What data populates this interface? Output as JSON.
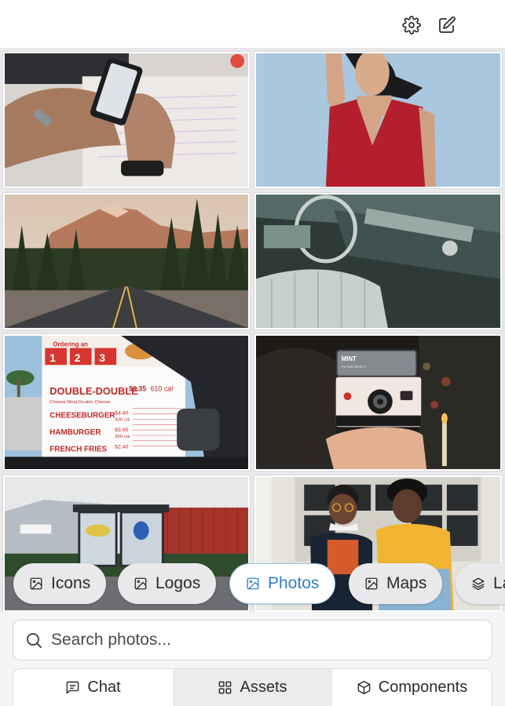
{
  "toolbar": {
    "settings_icon": "gear-icon",
    "compose_icon": "edit-icon"
  },
  "photos": [
    {
      "description": "Hands holding a smartphone over a notebook"
    },
    {
      "description": "Woman in a red dress against a blue sky"
    },
    {
      "description": "Road leading to a mountain through pine forest"
    },
    {
      "description": "Vintage car interior with green dashboard"
    },
    {
      "description": "Fast food menu board seen from a car",
      "menu": {
        "header": "Ordering an",
        "combos": [
          "1",
          "2",
          "3"
        ],
        "title": "DOUBLE-DOUBLE",
        "title_price": "$6.35",
        "title_cal": "610 cal",
        "subtitle": "Cheese Meat Double Cheese",
        "items": [
          {
            "name": "CHEESEBURGER",
            "price": "$4.40",
            "cal": "430 cal"
          },
          {
            "name": "HAMBURGER",
            "price": "$3.85",
            "cal": "360 cal"
          },
          {
            "name": "FRENCH FRIES",
            "price": "$2.40",
            "cal": ""
          }
        ]
      }
    },
    {
      "description": "Hand holding a vintage instant camera",
      "camera_label": "MINT",
      "camera_model": "FLASH BAR 2"
    },
    {
      "description": "Bus shelter in front of industrial buildings"
    },
    {
      "description": "Two smiling friends outdoors"
    }
  ],
  "categories": [
    {
      "label": "Icons",
      "icon": "image-icon",
      "active": false
    },
    {
      "label": "Logos",
      "icon": "image-icon",
      "active": false
    },
    {
      "label": "Photos",
      "icon": "image-icon",
      "active": true
    },
    {
      "label": "Maps",
      "icon": "image-icon",
      "active": false
    },
    {
      "label": "La",
      "icon": "layers-icon",
      "active": false
    }
  ],
  "search": {
    "placeholder": "Search photos...",
    "value": ""
  },
  "tabs": [
    {
      "label": "Chat",
      "icon": "message-square-icon",
      "active": false
    },
    {
      "label": "Assets",
      "icon": "grid-icon",
      "active": true
    },
    {
      "label": "Components",
      "icon": "cube-icon",
      "active": false
    }
  ],
  "colors": {
    "accent": "#2f80c9",
    "active_chip_border": "#9cc6ea",
    "background": "#ffffff"
  }
}
